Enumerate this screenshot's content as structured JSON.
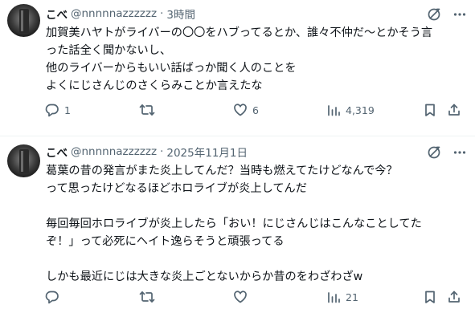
{
  "posts": [
    {
      "display_name": "こべ",
      "handle": "@nnnnnazzzzzz",
      "separator": "·",
      "time": "3時間",
      "lines": [
        "加賀美ハヤトがライバーの〇〇をハブってるとか、誰々不仲だ～とかそう言",
        "った話全く聞かないし、",
        "他のライバーからもいい話ばっか聞く人のことを",
        "よくにじさんじのさくらみことか言えたな"
      ],
      "reply_count": "1",
      "repost_count": "",
      "like_count": "6",
      "view_count": "4,319"
    },
    {
      "display_name": "こべ",
      "handle": "@nnnnnazzzzzz",
      "separator": "·",
      "time": "2025年11月1日",
      "lines": [
        "葛葉の昔の発言がまた炎上してんだ？当時も燃えてたけどなんで今？",
        "って思ったけどなるほどホロライブが炎上してんだ",
        "",
        "毎回毎回ホロライブが炎上したら「おい！にじさんじはこんなことしてた",
        "ぞ！」って必死にヘイト逸らそうと頑張ってる",
        "",
        "しかも最近にじは大きな炎上ごとないからか昔のをわざわざw"
      ],
      "reply_count": "",
      "repost_count": "",
      "like_count": "",
      "view_count": "21"
    }
  ],
  "icons": {
    "not_interested": "slashed-circle-icon",
    "more": "more-dots-icon",
    "reply": "reply-bubble-icon",
    "repost": "repost-arrows-icon",
    "like": "heart-icon",
    "views": "views-bar-icon",
    "bookmark": "bookmark-icon",
    "share": "share-icon"
  },
  "colors": {
    "text": "#0f1419",
    "secondary": "#536471",
    "divider": "#eff3f4"
  }
}
